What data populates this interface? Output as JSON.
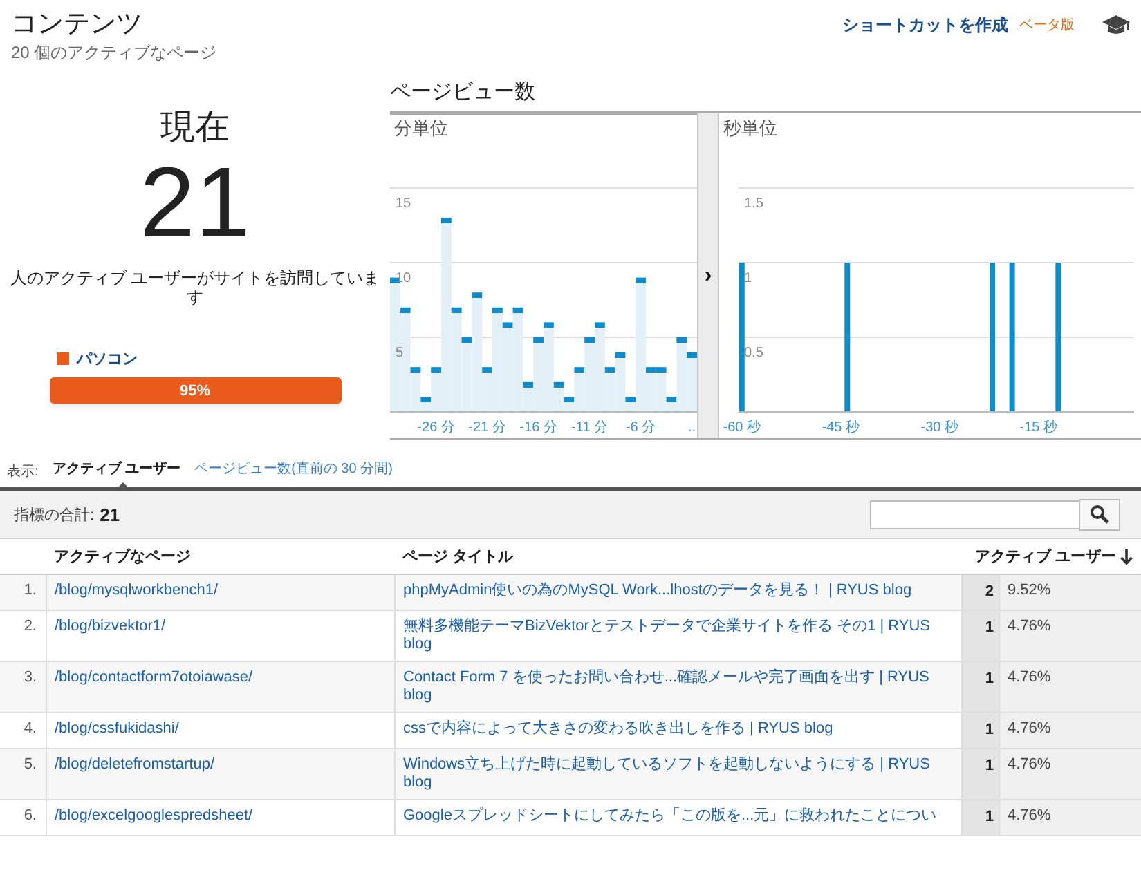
{
  "header": {
    "title": "コンテンツ",
    "subtitle": "20 個のアクティブなページ",
    "shortcut": "ショートカットを作成",
    "beta": "ベータ版"
  },
  "now": {
    "label": "現在",
    "count": "21",
    "caption": "人のアクティブ ユーザーがサイトを訪問しています",
    "devices": [
      {
        "name": "パソコン",
        "color": "#ea5b1e",
        "share": "95%"
      }
    ]
  },
  "pageviews": {
    "title": "ページビュー数",
    "minutes": {
      "chart_data": {
        "type": "bar",
        "title": "分単位",
        "grid": true,
        "ylim": [
          0,
          20
        ],
        "yticks": [
          5,
          10,
          15
        ],
        "x": [
          -30,
          -29,
          -28,
          -27,
          -26,
          -25,
          -24,
          -23,
          -22,
          -21,
          -20,
          -19,
          -18,
          -17,
          -16,
          -15,
          -14,
          -13,
          -12,
          -11,
          -10,
          -9,
          -8,
          -7,
          -6,
          -5,
          -4,
          -3,
          -2,
          -1
        ],
        "values": [
          9,
          7,
          3,
          1,
          3,
          13,
          7,
          5,
          8,
          3,
          7,
          6,
          7,
          2,
          5,
          6,
          2,
          1,
          3,
          5,
          6,
          3,
          4,
          1,
          9,
          3,
          3,
          1,
          5,
          4
        ],
        "xlim": [
          -30.5,
          -0.5
        ],
        "xticks": [
          {
            "value": -26,
            "label": "-26 分"
          },
          {
            "value": -21,
            "label": "-21 分"
          },
          {
            "value": -16,
            "label": "-16 分"
          },
          {
            "value": -11,
            "label": "-11 分"
          },
          {
            "value": -6,
            "label": "-6 分"
          },
          {
            "value": -1,
            "label": ".."
          }
        ]
      }
    },
    "expand": "›",
    "seconds": {
      "chart_data": {
        "type": "bar",
        "title": "秒単位",
        "grid": true,
        "ylim": [
          0,
          2
        ],
        "xlim": [
          -60,
          -1
        ],
        "yticks": [
          0.5,
          1,
          1.5
        ],
        "x": [
          -60,
          -44,
          -22,
          -19,
          -12
        ],
        "values": [
          1,
          1,
          1,
          1,
          1
        ],
        "xticks": [
          {
            "value": -60,
            "label": "-60 秒"
          },
          {
            "value": -45,
            "label": "-45 秒"
          },
          {
            "value": -30,
            "label": "-30 秒"
          },
          {
            "value": -15,
            "label": "-15 秒"
          }
        ]
      }
    }
  },
  "view": {
    "label": "表示:",
    "tabs": [
      {
        "label": "アクティブ ユーザー",
        "selected": true
      },
      {
        "label": "ページビュー数(直前の 30 分間)",
        "selected": false
      }
    ]
  },
  "summary": {
    "label": "指標の合計:",
    "value": "21"
  },
  "table": {
    "columns": [
      "アクティブなページ",
      "ページ タイトル",
      "アクティブ ユーザー"
    ],
    "rows": [
      {
        "index": "1.",
        "page": "/blog/mysqlworkbench1/",
        "title": "phpMyAdmin使いの為のMySQL Work...lhostのデータを見る！ | RYUS blog",
        "users": "2",
        "share": "9.52%"
      },
      {
        "index": "2.",
        "page": "/blog/bizvektor1/",
        "title": "無料多機能テーマBizVektorとテストデータで企業サイトを作る その1 | RYUS blog",
        "users": "1",
        "share": "4.76%"
      },
      {
        "index": "3.",
        "page": "/blog/contactform7otoiawase/",
        "title": "Contact Form 7 を使ったお問い合わせ...確認メールや完了画面を出す | RYUS blog",
        "users": "1",
        "share": "4.76%"
      },
      {
        "index": "4.",
        "page": "/blog/cssfukidashi/",
        "title": "cssで内容によって大きさの変わる吹き出しを作る | RYUS blog",
        "users": "1",
        "share": "4.76%"
      },
      {
        "index": "5.",
        "page": "/blog/deletefromstartup/",
        "title": "Windows立ち上げた時に起動しているソフトを起動しないようにする | RYUS blog",
        "users": "1",
        "share": "4.76%"
      },
      {
        "index": "6.",
        "page": "/blog/excelgooglespredsheet/",
        "title": "Googleスプレッドシートにしてみたら「この版を...元」に救われたことについ",
        "users": "1",
        "share": "4.76%"
      }
    ]
  }
}
